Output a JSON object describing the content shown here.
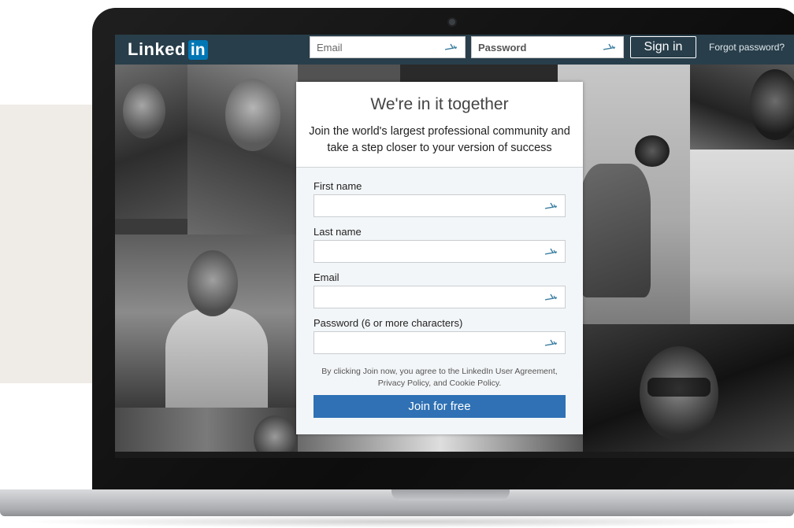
{
  "header": {
    "logo_text": "Linked",
    "logo_badge": "in",
    "email_placeholder": "Email",
    "password_placeholder": "Password",
    "sign_in_label": "Sign in",
    "forgot_label": "Forgot password?"
  },
  "card": {
    "title": "We're in it together",
    "subtitle_line1": "Join the world's largest professional community and",
    "subtitle_line2": "take a step closer to your version of success",
    "fields": [
      {
        "label": "First name",
        "value": ""
      },
      {
        "label": "Last name",
        "value": ""
      },
      {
        "label": "Email",
        "value": ""
      },
      {
        "label": "Password (6 or more characters)",
        "value": ""
      }
    ],
    "legal_line1": "By clicking Join now, you agree to the LinkedIn User Agreement,",
    "legal_line2": "Privacy Policy, and Cookie Policy.",
    "join_label": "Join for free"
  },
  "icons": {
    "field_icon": "password-manager-key-icon"
  },
  "colors": {
    "header_bg": "#283e4a",
    "brand_blue": "#0077b5",
    "join_button": "#2f71b4",
    "card_bg": "#f3f6f8"
  }
}
